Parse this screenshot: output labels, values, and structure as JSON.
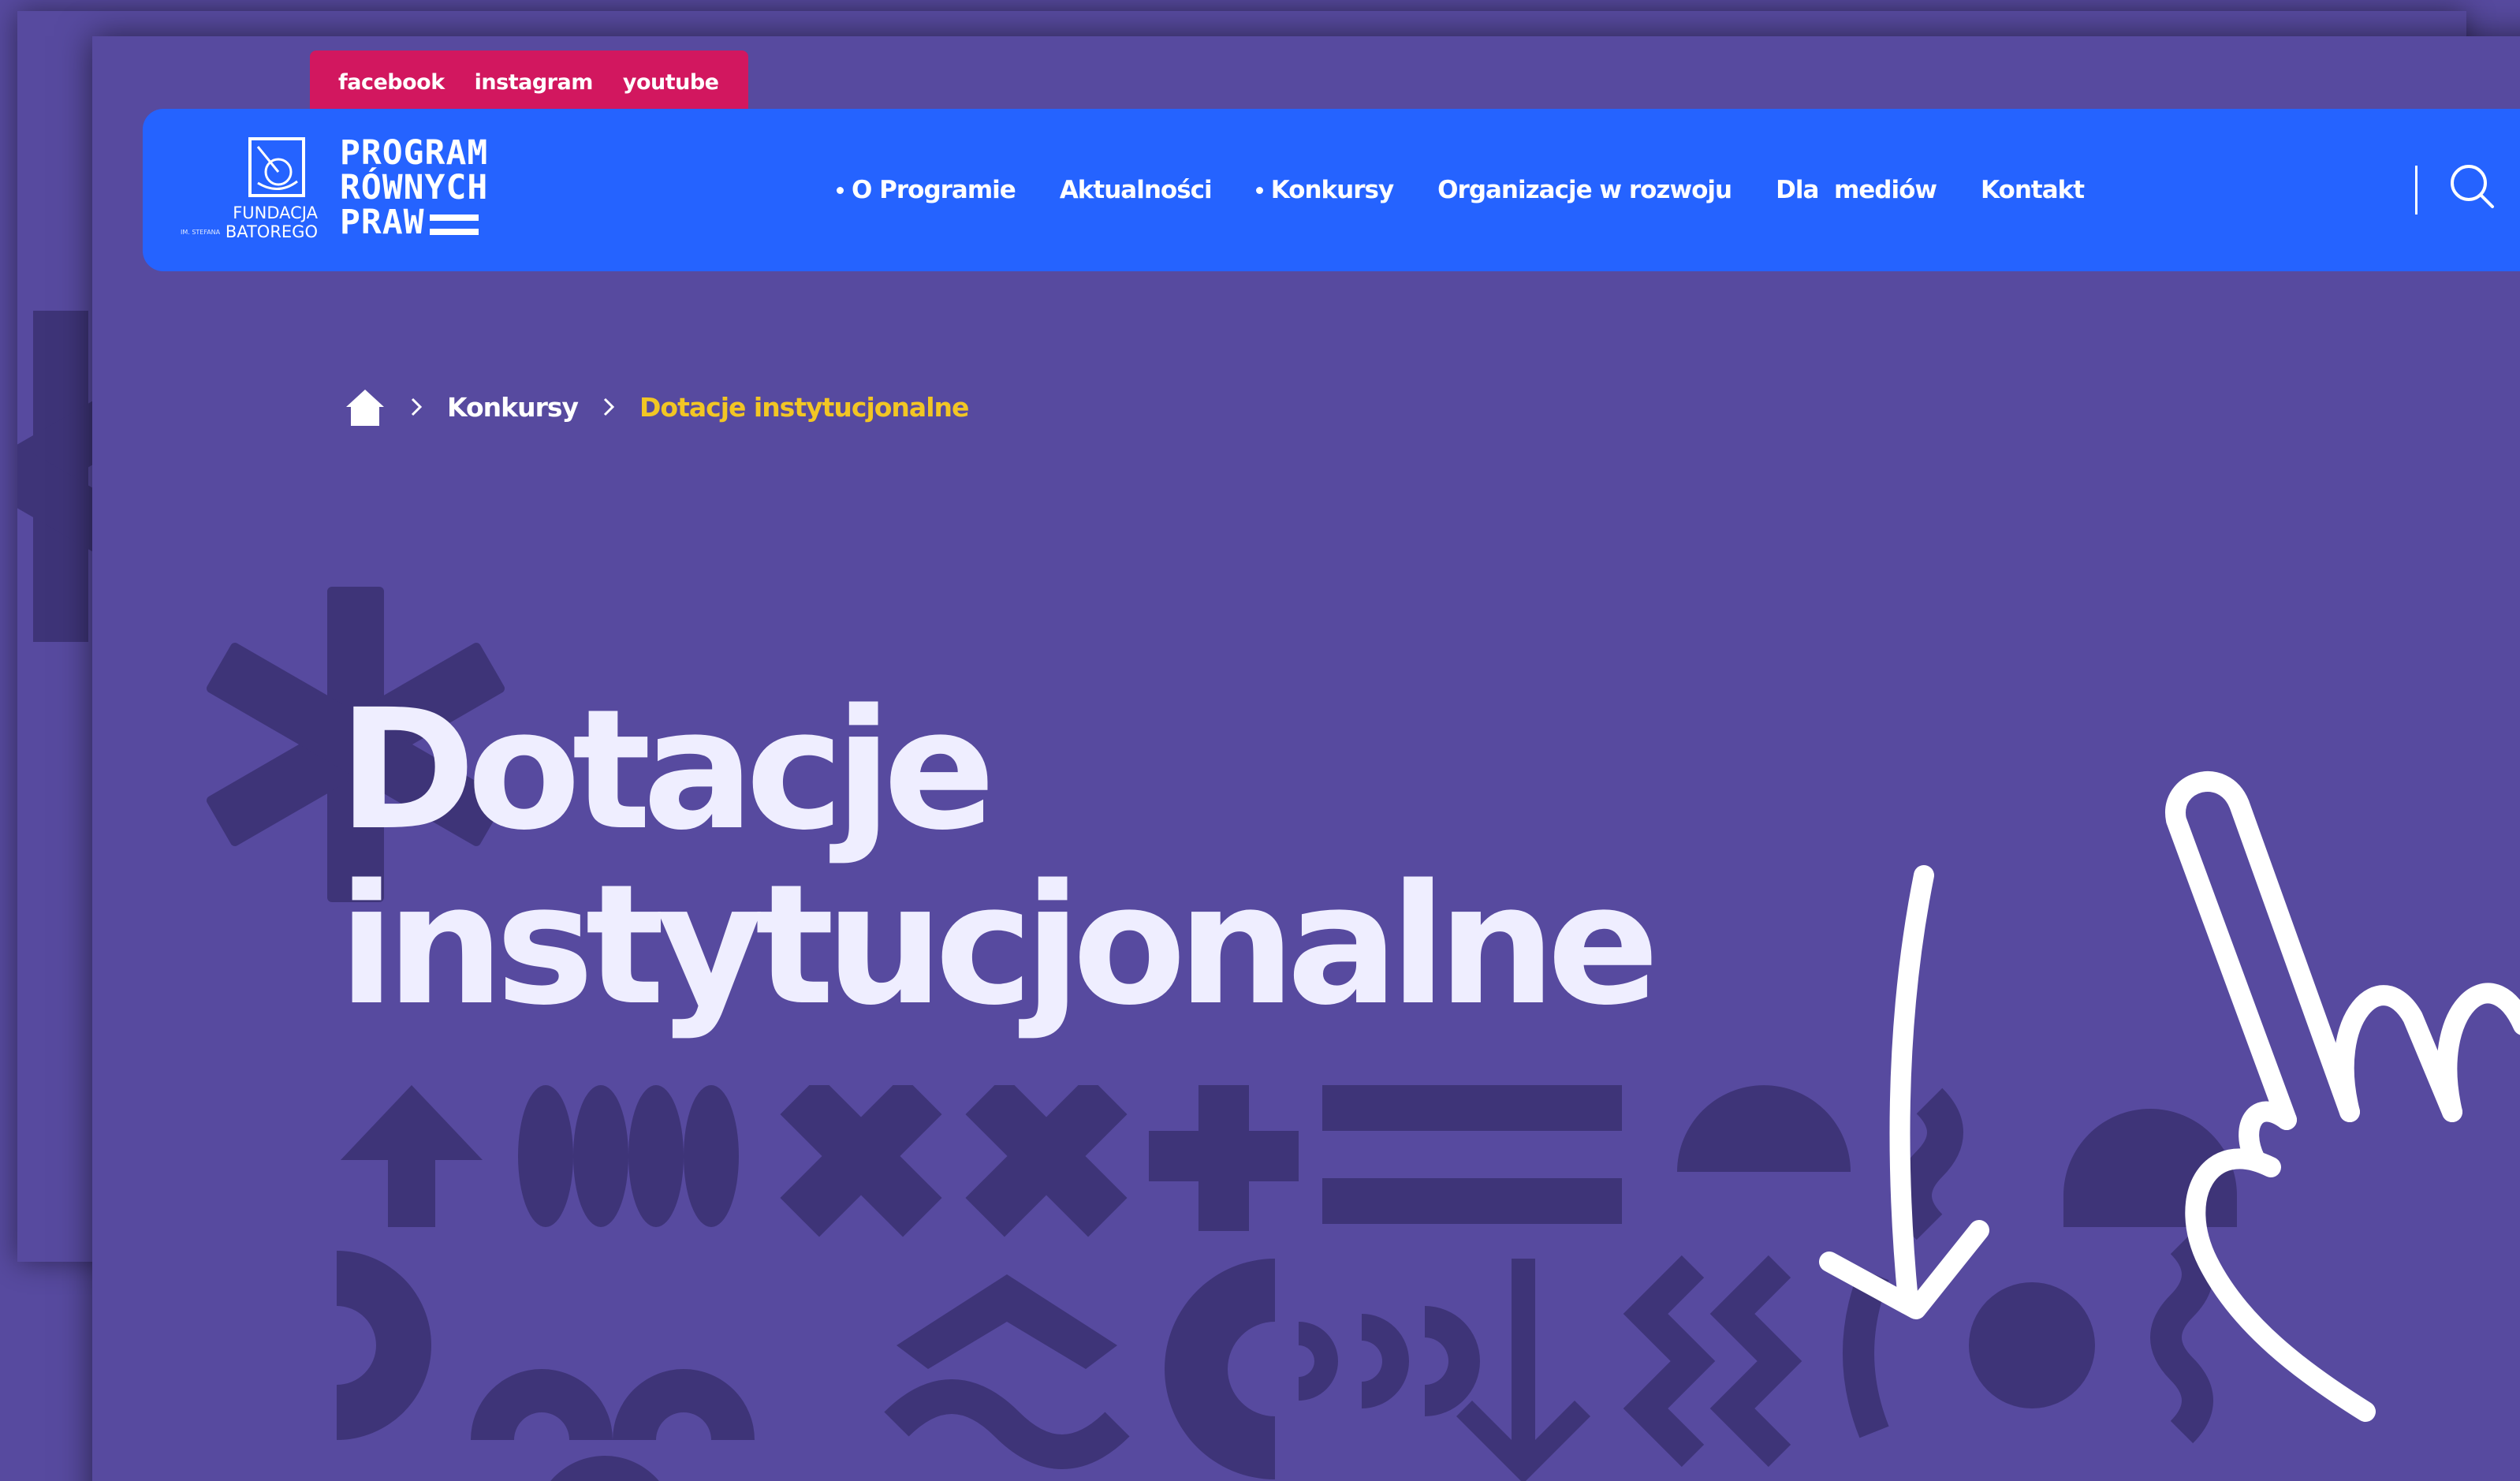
{
  "social": {
    "links": [
      "facebook",
      "instagram",
      "youtube"
    ]
  },
  "brand": {
    "foundation_line1": "FUNDACJA",
    "foundation_small": "IM. STEFANA",
    "foundation_line2": "BATOREGO",
    "program_line1": "PROGRAM",
    "program_line2": "RÓWNYCH",
    "program_line3": "PRAW"
  },
  "nav": {
    "items": [
      {
        "label": "O Programie",
        "dot": true
      },
      {
        "label": "Aktualności",
        "dot": false
      },
      {
        "label": "Konkursy",
        "dot": true
      },
      {
        "label": "Organizacje w rozwoju",
        "dot": false
      },
      {
        "label": "Dla  mediów",
        "dot": false
      },
      {
        "label": "Kontakt",
        "dot": false
      }
    ],
    "search_icon": "search-icon"
  },
  "breadcrumb": {
    "home_icon": "home-icon",
    "items": [
      "Konkursy"
    ],
    "current": "Dotacje instytucjonalne"
  },
  "hero": {
    "title_line1": "Dotacje",
    "title_line2": "instytucjonalne"
  },
  "colors": {
    "background": "#574a9f",
    "header": "#2563ff",
    "social_bar": "#d2175f",
    "breadcrumb_current": "#f2c624",
    "title": "#efeeff",
    "shapes": "#3e3478"
  }
}
